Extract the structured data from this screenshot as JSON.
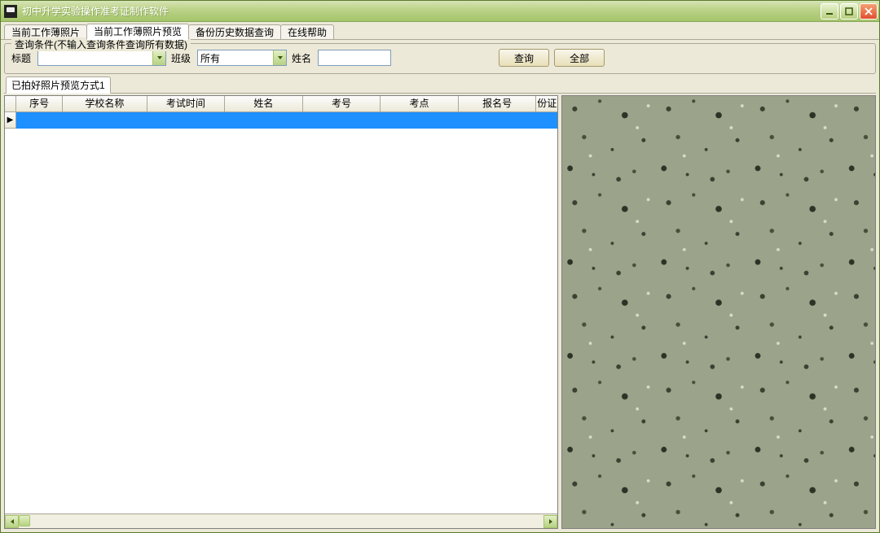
{
  "title": "初中升学实验操作准考证制作软件",
  "tabs": {
    "t0": "当前工作薄照片",
    "t1": "当前工作薄照片预览",
    "t2": "备份历史数据查询",
    "t3": "在线帮助"
  },
  "fieldset_legend": "查询条件(不输入查询条件查询所有数据)",
  "filters": {
    "label_title": "标题",
    "title_value": "",
    "label_class": "班级",
    "class_value": "所有",
    "label_name": "姓名",
    "name_value": "",
    "btn_query": "查询",
    "btn_all": "全部"
  },
  "sub_tab": "已拍好照片预览方式1",
  "columns": {
    "c0": "序号",
    "c1": "学校名称",
    "c2": "考试时间",
    "c3": "姓名",
    "c4": "考号",
    "c5": "考点",
    "c6": "报名号",
    "c7": "份证"
  },
  "row_indicator": "▶"
}
